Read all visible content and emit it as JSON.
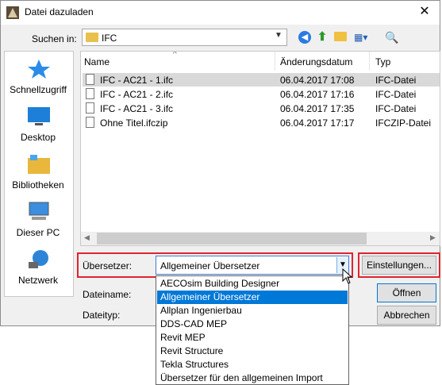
{
  "window": {
    "title": "Datei dazuladen",
    "close": "✕"
  },
  "lookin": {
    "label": "Suchen in:",
    "value": "IFC"
  },
  "places": [
    {
      "label": "Schnellzugriff",
      "icon": "star-icon"
    },
    {
      "label": "Desktop",
      "icon": "desktop-icon"
    },
    {
      "label": "Bibliotheken",
      "icon": "library-icon"
    },
    {
      "label": "Dieser PC",
      "icon": "computer-icon"
    },
    {
      "label": "Netzwerk",
      "icon": "network-icon"
    }
  ],
  "columns": {
    "name": "Name",
    "date": "Änderungsdatum",
    "type": "Typ"
  },
  "files": [
    {
      "name": "IFC - AC21 - 1.ifc",
      "date": "06.04.2017 17:08",
      "type": "IFC-Datei"
    },
    {
      "name": "IFC - AC21 - 2.ifc",
      "date": "06.04.2017 17:16",
      "type": "IFC-Datei"
    },
    {
      "name": "IFC - AC21 - 3.ifc",
      "date": "06.04.2017 17:35",
      "type": "IFC-Datei"
    },
    {
      "name": "Ohne Titel.ifczip",
      "date": "06.04.2017 17:17",
      "type": "IFCZIP-Datei"
    }
  ],
  "translator": {
    "label": "Übersetzer:",
    "value": "Allgemeiner Übersetzer",
    "settings_button": "Einstellungen...",
    "options": [
      "AECOsim Building Designer",
      "Allgemeiner Übersetzer",
      "Allplan Ingenierbau",
      "DDS-CAD MEP",
      "Revit MEP",
      "Revit Structure",
      "Tekla Structures",
      "Übersetzer für den allgemeinen Import"
    ],
    "highlight_color": "#0078d7"
  },
  "fields": {
    "filename_label": "Dateiname:",
    "filetype_label": "Dateityp:"
  },
  "buttons": {
    "open": "Öffnen",
    "cancel": "Abbrechen"
  },
  "colors": {
    "annotation_red": "#e0242f"
  }
}
